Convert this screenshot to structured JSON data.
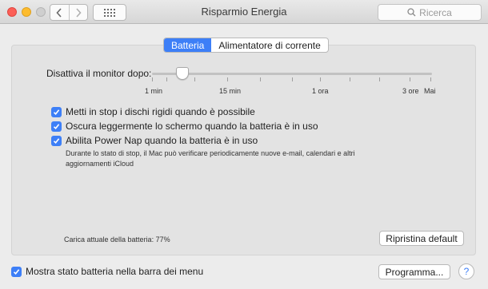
{
  "window": {
    "title": "Risparmio Energia",
    "search_placeholder": "Ricerca"
  },
  "tabs": [
    {
      "label": "Batteria",
      "active": true
    },
    {
      "label": "Alimentatore di corrente",
      "active": false
    }
  ],
  "slider": {
    "label": "Disattiva il monitor dopo:",
    "ticks": [
      "1 min",
      "15 min",
      "1 ora",
      "3 ore",
      "Mai"
    ],
    "value": "2 min"
  },
  "options": [
    {
      "label": "Metti in stop i dischi rigidi quando è possibile",
      "checked": true
    },
    {
      "label": "Oscura leggermente lo schermo quando la batteria è in uso",
      "checked": true
    },
    {
      "label": "Abilita Power Nap quando la batteria è in uso",
      "checked": true
    }
  ],
  "power_nap_description": "Durante lo stato di stop, il Mac può verificare periodicamente nuove e-mail, calendari e altri aggiornamenti iCloud",
  "battery_charge": "Carica attuale della batteria: 77%",
  "restore_button": "Ripristina default",
  "show_status": {
    "label": "Mostra stato batteria nella barra dei menu",
    "checked": true
  },
  "schedule_button": "Programma...",
  "help_label": "?",
  "accent_color": "#3d7ff7"
}
